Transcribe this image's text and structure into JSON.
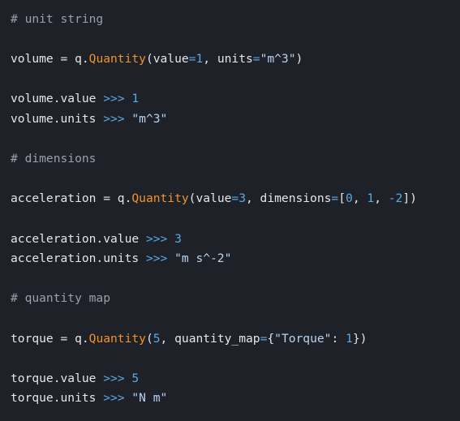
{
  "colors": {
    "background": "#1e2128",
    "text": "#e6e6e6",
    "comment": "#9aa0a8",
    "operator": "#5aa9e6",
    "class": "#f0932b",
    "number": "#5aa9e6",
    "string": "#b9d4f0"
  },
  "code": {
    "comment_unit": "# unit string",
    "volume_var": "volume",
    "volume_assign": " = q.",
    "quantity_cls_1": "Quantity",
    "volume_args_open": "(value",
    "eq_1": "=",
    "volume_value_num": "1",
    "volume_args_mid": ", units",
    "eq_2": "=",
    "volume_units_str": "\"m^3\"",
    "close_paren_1": ")",
    "volume_value_expr": "volume.value",
    "volume_value_prompt": " >>> 1",
    "volume_units_expr": "volume.units",
    "volume_units_prompt": " >>> ",
    "volume_units_out": "\"m^3\"",
    "comment_dim": "# dimensions",
    "accel_var": "acceleration",
    "accel_assign": " = q.",
    "quantity_cls_2": "Quantity",
    "accel_args_open": "(value",
    "eq_3": "=",
    "accel_value_num": "3",
    "accel_args_mid": ", dimensions",
    "eq_4": "=",
    "accel_dims_open": "[",
    "accel_dim_0": "0",
    "accel_sep_1": ", ",
    "accel_dim_1": "1",
    "accel_sep_2": ", ",
    "accel_dim_2": "-2",
    "accel_dims_close": "])",
    "accel_value_expr": "acceleration.value",
    "accel_value_prompt": " >>> 3",
    "accel_units_expr": "acceleration.units",
    "accel_units_prompt": " >>> ",
    "accel_units_out": "\"m s^-2\"",
    "comment_qmap": "# quantity map",
    "torque_var": "torque",
    "torque_assign": " = q.",
    "quantity_cls_3": "Quantity",
    "torque_paren_open": "(",
    "torque_num": "5",
    "torque_args_mid": ", quantity_map",
    "eq_5": "=",
    "torque_brace_open": "{",
    "torque_key": "\"Torque\"",
    "torque_colon": ": ",
    "torque_map_val": "1",
    "torque_close": "})",
    "torque_value_expr": "torque.value",
    "torque_value_prompt": " >>> 5",
    "torque_units_expr": "torque.units",
    "torque_units_prompt": " >>> ",
    "torque_units_out": "\"N m\""
  }
}
